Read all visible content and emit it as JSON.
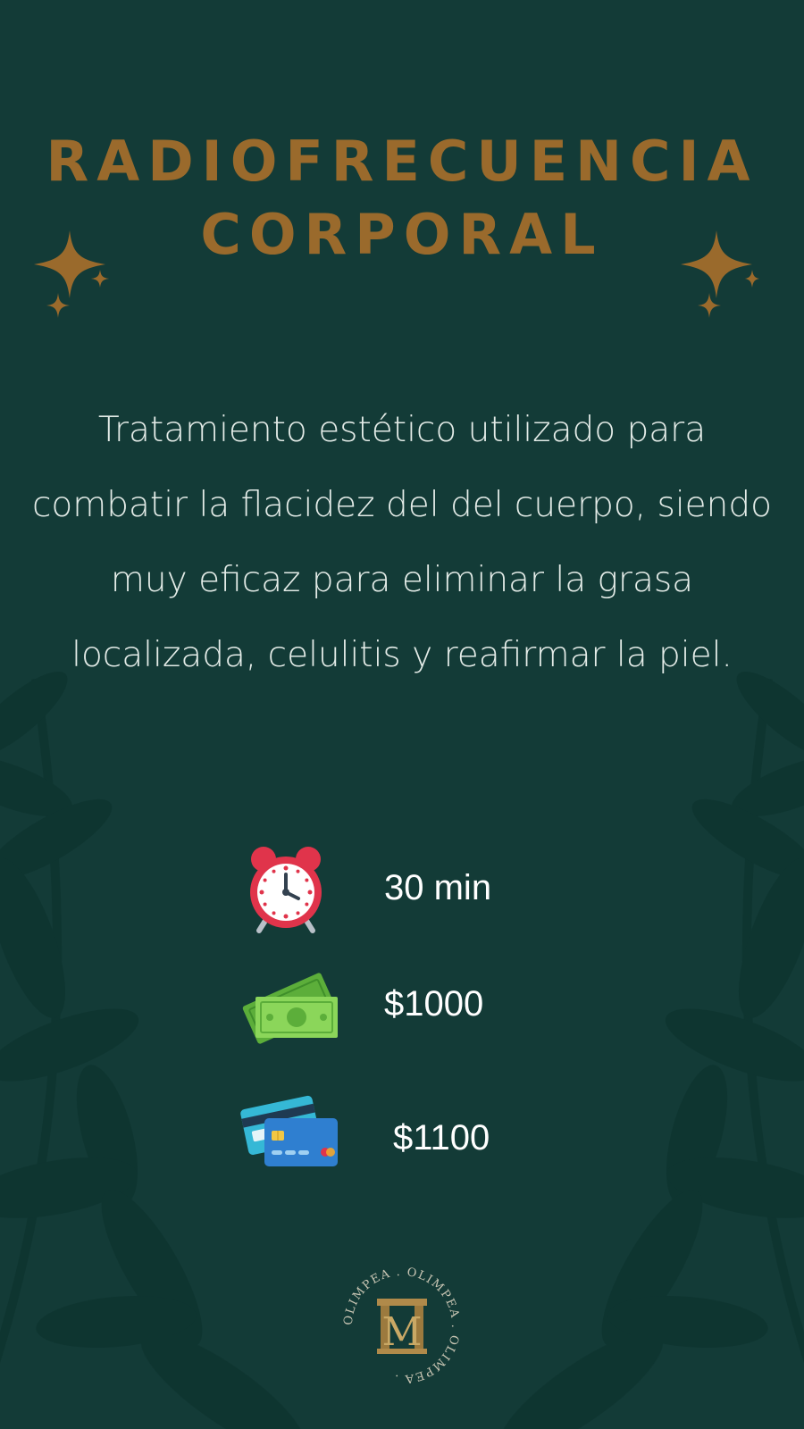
{
  "title": {
    "line1": "RADIOFRECUENCIA",
    "line2": "CORPORAL"
  },
  "description": "Tratamiento estético utilizado para combatir la flacidez del del cuerpo, siendo muy eficaz para eliminar  la grasa localizada, celulitis y reafirmar la piel.",
  "details": [
    {
      "icon": "alarm-clock-icon",
      "value": "30 min"
    },
    {
      "icon": "cash-icon",
      "value": "$1000"
    },
    {
      "icon": "credit-card-icon",
      "value": "$1100"
    }
  ],
  "logo": {
    "ring_text": "OLIMPEA . OLIMPEA . OLIMPEA . ",
    "monogram": "M"
  },
  "colors": {
    "background": "#133b37",
    "title_gold": "#9a6a2c",
    "text": "#e4ece8"
  }
}
